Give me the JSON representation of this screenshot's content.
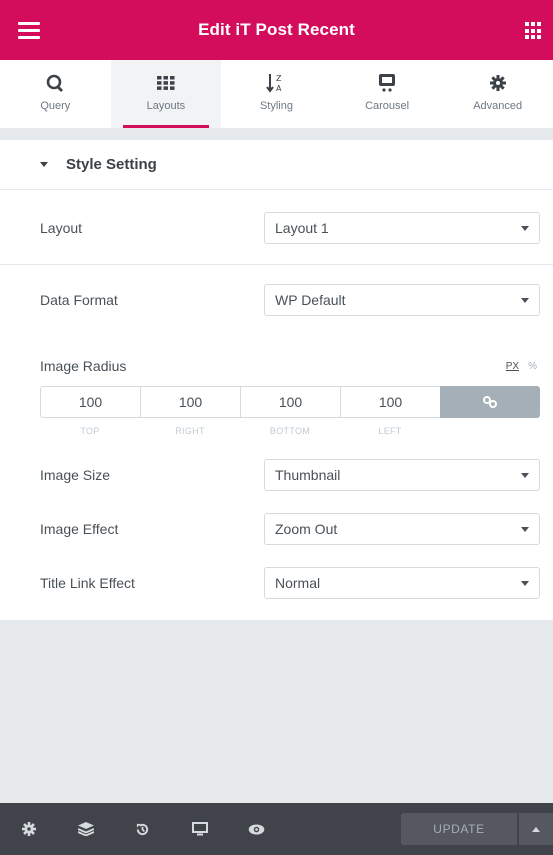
{
  "header": {
    "title": "Edit iT Post Recent"
  },
  "tabs": [
    {
      "label": "Query",
      "icon": "query-icon"
    },
    {
      "label": "Layouts",
      "icon": "grid-icon"
    },
    {
      "label": "Styling",
      "icon": "sort-az-icon"
    },
    {
      "label": "Carousel",
      "icon": "carousel-icon"
    },
    {
      "label": "Advanced",
      "icon": "gear-icon"
    }
  ],
  "active_tab": "Layouts",
  "section": {
    "title": "Style Setting"
  },
  "controls": {
    "layout": {
      "label": "Layout",
      "value": "Layout 1"
    },
    "data_format": {
      "label": "Data Format",
      "value": "WP Default"
    },
    "image_radius": {
      "label": "Image Radius",
      "units": [
        "PX",
        "%"
      ],
      "active_unit": "PX",
      "top": "100",
      "right": "100",
      "bottom": "100",
      "left": "100",
      "top_label": "TOP",
      "right_label": "RIGHT",
      "bottom_label": "BOTTOM",
      "left_label": "LEFT"
    },
    "image_size": {
      "label": "Image Size",
      "value": "Thumbnail"
    },
    "image_effect": {
      "label": "Image Effect",
      "value": "Zoom Out"
    },
    "title_link_effect": {
      "label": "Title Link Effect",
      "value": "Normal"
    }
  },
  "footer": {
    "icons": [
      "settings-icon",
      "layers-icon",
      "history-icon",
      "responsive-icon",
      "preview-icon"
    ],
    "update_label": "UPDATE"
  },
  "colors": {
    "brand": "#d30c5c",
    "footer": "#404349",
    "text": "#495157"
  }
}
